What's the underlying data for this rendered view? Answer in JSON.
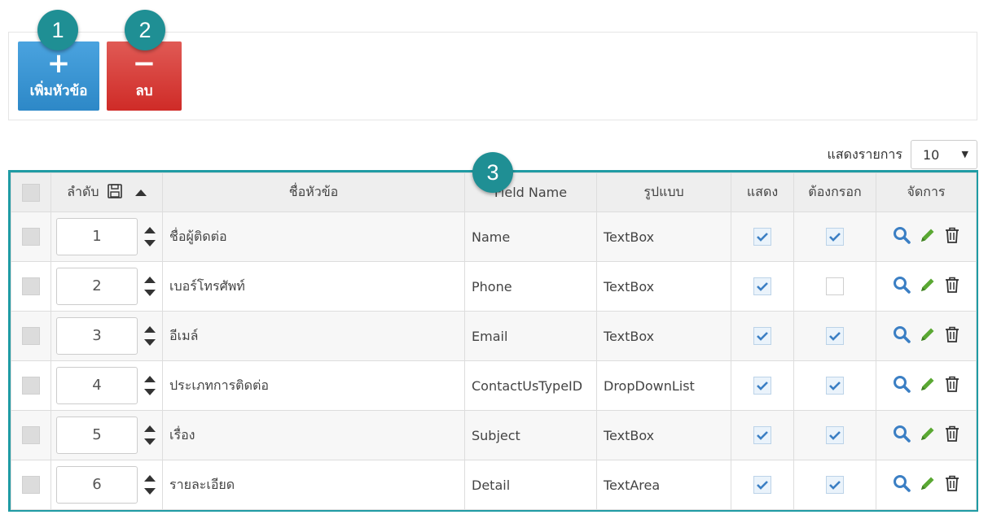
{
  "toolbar": {
    "add_label": "เพิ่มหัวข้อ",
    "delete_label": "ลบ"
  },
  "badges": [
    "1",
    "2",
    "3"
  ],
  "page_size": {
    "label": "แสดงรายการ",
    "value": "10"
  },
  "table": {
    "headers": {
      "order": "ลำดับ",
      "title": "ชื่อหัวข้อ",
      "field_name": "Field Name",
      "format": "รูปแบบ",
      "show": "แสดง",
      "required": "ต้องกรอก",
      "manage": "จัดการ"
    },
    "rows": [
      {
        "order": "1",
        "title": "ชื่อผู้ติดต่อ",
        "field_name": "Name",
        "format": "TextBox",
        "show": true,
        "required": true
      },
      {
        "order": "2",
        "title": "เบอร์โทรศัพท์",
        "field_name": "Phone",
        "format": "TextBox",
        "show": true,
        "required": false
      },
      {
        "order": "3",
        "title": "อีเมล์",
        "field_name": "Email",
        "format": "TextBox",
        "show": true,
        "required": true
      },
      {
        "order": "4",
        "title": "ประเภทการติดต่อ",
        "field_name": "ContactUsTypeID",
        "format": "DropDownList",
        "show": true,
        "required": true
      },
      {
        "order": "5",
        "title": "เรื่อง",
        "field_name": "Subject",
        "format": "TextBox",
        "show": true,
        "required": true
      },
      {
        "order": "6",
        "title": "รายละเอียด",
        "field_name": "Detail",
        "format": "TextArea",
        "show": true,
        "required": true
      }
    ]
  },
  "colors": {
    "accent": "#1f9ba4",
    "add_button": "#2d88c7",
    "delete_button": "#cf2b27",
    "view_icon": "#3b7fc4",
    "edit_icon": "#5aa833"
  }
}
